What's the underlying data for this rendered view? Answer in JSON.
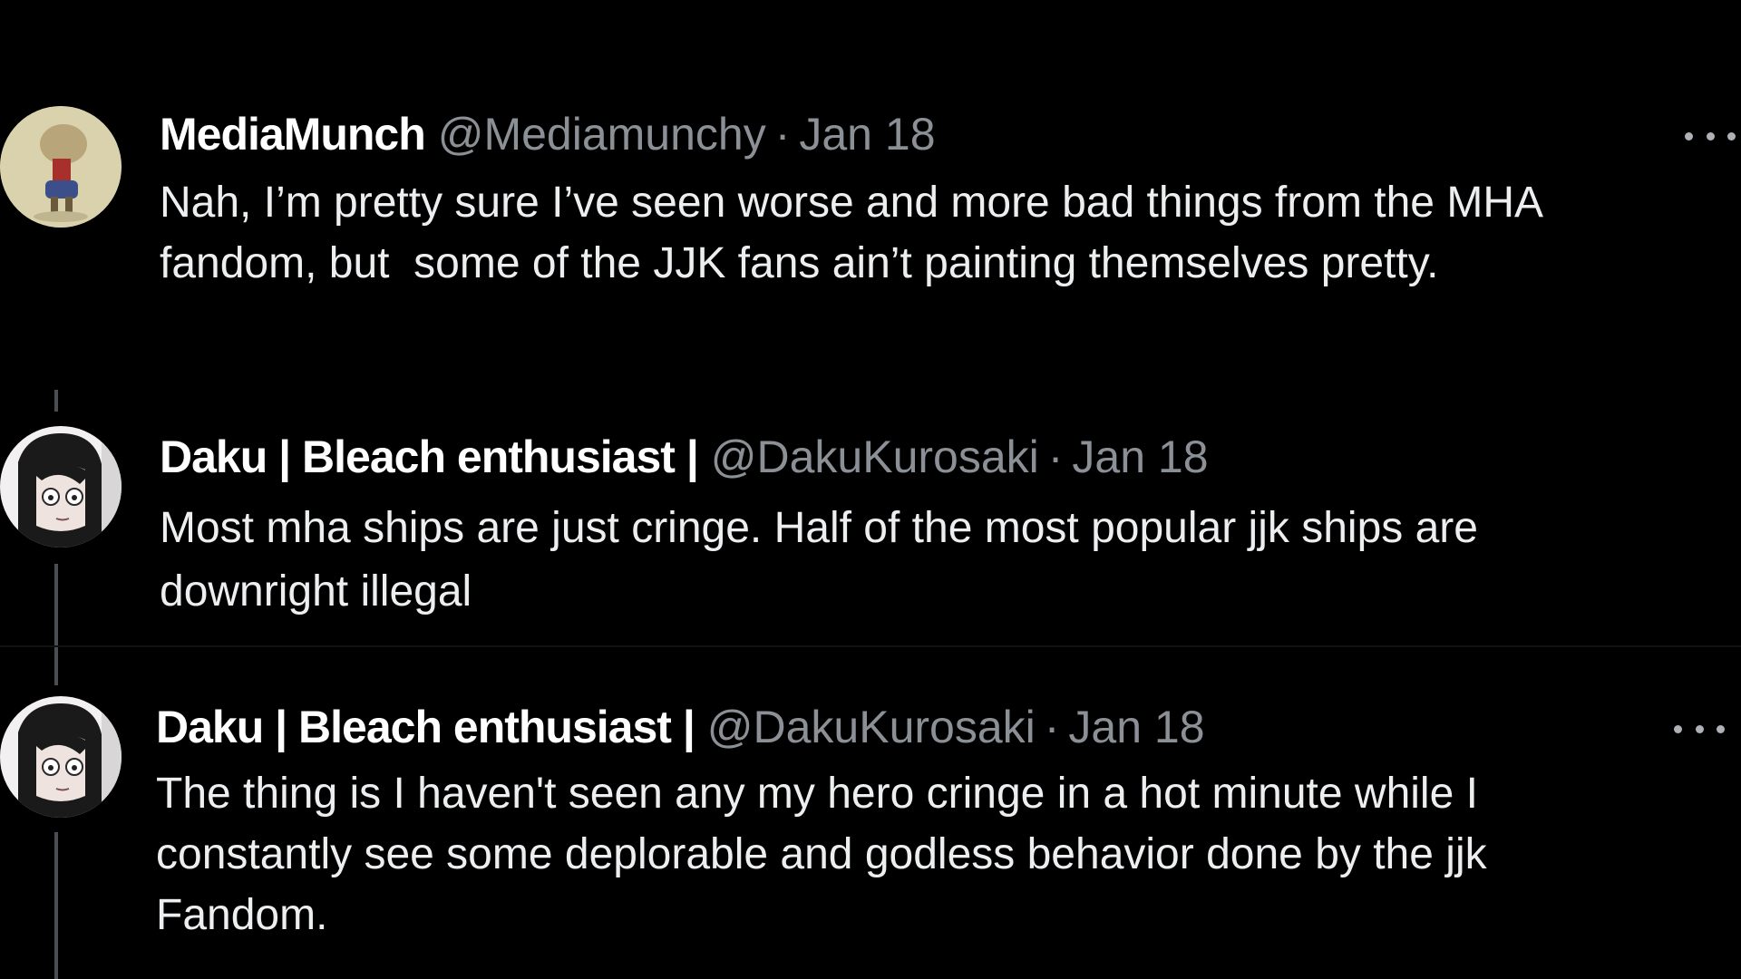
{
  "tweets": [
    {
      "name": "MediaMunch",
      "handle": "@Mediamunchy",
      "separator": "·",
      "date": "Jan 18",
      "text": "Nah, I’m pretty sure I’ve seen worse and more bad things from the MHA\nfandom, but  some of the JJK fans ain’t painting themselves pretty.",
      "avatar_icon": "cartoon-character-avatar",
      "has_more_menu": true
    },
    {
      "name": "Daku | Bleach enthusiast |",
      "handle": "@DakuKurosaki",
      "separator": "·",
      "date": "Jan 18",
      "text": "Most mha ships are just cringe. Half of the most popular jjk ships are\ndownright illegal",
      "avatar_icon": "anime-girl-avatar",
      "has_more_menu": false
    },
    {
      "name": "Daku | Bleach enthusiast |",
      "handle": "@DakuKurosaki",
      "separator": "·",
      "date": "Jan 18",
      "text": "The thing is I haven't seen any my hero cringe in a hot minute while I\nconstantly see some deplorable and godless behavior done by the jjk\nFandom.",
      "avatar_icon": "anime-girl-avatar",
      "has_more_menu": true
    }
  ],
  "colors": {
    "background": "#000000",
    "name": "#ffffff",
    "secondary_text": "#8b9096",
    "body_text": "#eceef0",
    "thread_line": "#4a4d52"
  }
}
